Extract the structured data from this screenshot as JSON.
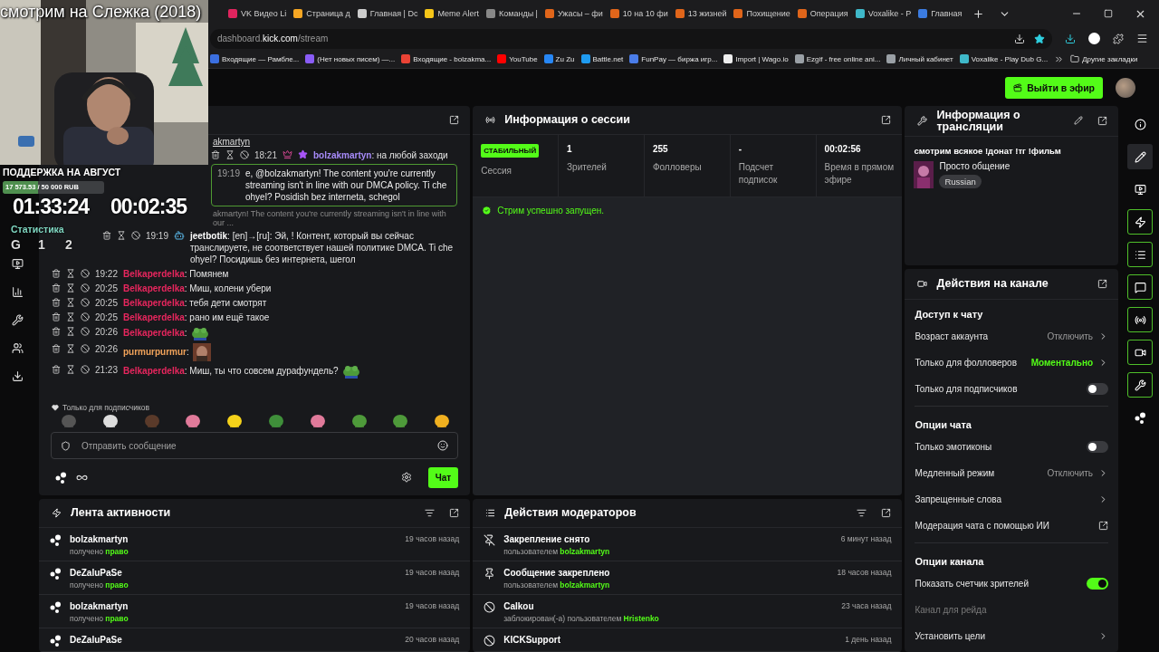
{
  "overlay": {
    "title": "смотрим на Слежка (2018)",
    "goal_title": "ПОДДЕРЖКА НА АВГУСТ",
    "goal_text": "17 573.53 / 50 000 RUB",
    "goal": {
      "level": 0.35
    },
    "timer_total": "01:33:24",
    "timer_session": "00:02:35",
    "stats_label": "Статистика",
    "stats": [
      "G",
      "1",
      "2"
    ]
  },
  "browser": {
    "tabs": [
      {
        "title": "VK Видео Li",
        "color": "#e0245e",
        "selected": false
      },
      {
        "title": "Страница д",
        "color": "#f5a623",
        "selected": false
      },
      {
        "title": "Главная | Dc",
        "color": "#cccccc",
        "selected": false
      },
      {
        "title": "Meme Alert",
        "color": "#f5c518",
        "selected": false
      },
      {
        "title": "Команды | ",
        "color": "#888888",
        "selected": false
      },
      {
        "title": "Ужасы – фи",
        "color": "#e0651a",
        "selected": false
      },
      {
        "title": "10 на 10 фи",
        "color": "#e0651a",
        "selected": false
      },
      {
        "title": "13 жизней",
        "color": "#e0651a",
        "selected": false
      },
      {
        "title": "Похищение",
        "color": "#e0651a",
        "selected": false
      },
      {
        "title": "Операция",
        "color": "#e0651a",
        "selected": false
      },
      {
        "title": "Voxalike - P",
        "color": "#3fb8c9",
        "selected": false
      },
      {
        "title": "Главная",
        "color": "#3b7be0",
        "selected": false
      }
    ],
    "address": {
      "prefix": "dashboard.",
      "host": "kick.com",
      "path": "/stream"
    },
    "bookmarks": [
      {
        "title": "Входящие — Рамбле...",
        "color": "#3b6fe0"
      },
      {
        "title": "(Нет новых писем) —...",
        "color": "#8a5cf6"
      },
      {
        "title": "Входящие - bolzakma...",
        "color": "#ea4335"
      },
      {
        "title": "YouTube",
        "color": "#ff0000"
      },
      {
        "title": "Zu Zu",
        "color": "#2787f5"
      },
      {
        "title": "Battle.net",
        "color": "#1f9bf0"
      },
      {
        "title": "FunPay — биржа игр...",
        "color": "#4a7ce8"
      },
      {
        "title": "Import | Wago.io",
        "color": "#eeeeee"
      },
      {
        "title": "Ezgif - free online ani...",
        "color": "#9aa0a6"
      },
      {
        "title": "Личный кабинет",
        "color": "#9aa0a6"
      },
      {
        "title": "Voxalike - Play Dub G...",
        "color": "#3fb8c9"
      }
    ],
    "other_bookmarks": "Другие закладки"
  },
  "topbar": {
    "go_live": "Выйти в эфир"
  },
  "chat": {
    "pinned_by": "akmartyn",
    "messages": [
      {
        "kind": "message",
        "time": "18:21",
        "badge": {
          "kind": "sub"
        },
        "user": "bolzakmartyn",
        "color": "#a78bfa",
        "text": ": на любой заходи"
      },
      {
        "kind": "pinned",
        "time": "19:19",
        "text": "e, @bolzakmartyn! The content you're currently streaming isn't in line with our DMCA policy. Ti che ohyel? Posidish bez interneta, schegol"
      },
      {
        "kind": "reply",
        "text": "akmartyn! The content you're currently streaming isn't in line with our ..."
      },
      {
        "kind": "message",
        "time": "19:19",
        "badge": {
          "kind": "bot"
        },
        "user": "jeetbotik",
        "color": "#ffffff",
        "text": ": [en]→[ru]: Эй, ! Контент, который вы сейчас транслируете, не соответствует нашей политике DMCA. Ti che ohyel? Посидишь без интернета, шегол"
      },
      {
        "kind": "message",
        "time": "19:22",
        "user": "Belkaperdelka",
        "color": "#e8265e",
        "text": ": Помянем"
      },
      {
        "kind": "message",
        "time": "20:25",
        "user": "Belkaperdelka",
        "color": "#e8265e",
        "text": ": Миш, колени убери"
      },
      {
        "kind": "message",
        "time": "20:25",
        "user": "Belkaperdelka",
        "color": "#e8265e",
        "text": ": тебя дети смотрят"
      },
      {
        "kind": "message",
        "time": "20:25",
        "user": "Belkaperdelka",
        "color": "#e8265e",
        "text": ": рано им ещё такое"
      },
      {
        "kind": "message",
        "time": "20:26",
        "user": "Belkaperdelka",
        "color": "#e8265e",
        "text": ":",
        "emote": {
          "kind": "frog"
        }
      },
      {
        "kind": "message",
        "time": "20:26",
        "user": "purmurpurmur",
        "color": "#f0a25a",
        "text": ":"
      },
      {
        "kind": "message",
        "time": "21:23",
        "user": "Belkaperdelka",
        "color": "#e8265e",
        "text": ": Миш, ты что совсем дурафундель?",
        "emote": {
          "kind": "frog"
        }
      }
    ],
    "emotes_label": "Только для подписчиков",
    "input": {
      "placeholder": "Отправить сообщение"
    },
    "send": "Чат"
  },
  "activity": {
    "title": "Лента активности",
    "rows": [
      {
        "user": "bolzakmartyn",
        "action": "получено",
        "highlight": "право",
        "time": "19 часов назад"
      },
      {
        "user": "DeZaluPaSe",
        "action": "получено",
        "highlight": "право",
        "time": "19 часов назад"
      },
      {
        "user": "bolzakmartyn",
        "action": "получено",
        "highlight": "право",
        "time": "19 часов назад"
      },
      {
        "user": "DeZaluPaSe",
        "time": "20 часов назад"
      }
    ]
  },
  "session": {
    "title": "Информация о сессии",
    "status": "СТАБИЛЬНЫЙ",
    "status_label": "Сессия",
    "stats": [
      {
        "value": "1",
        "label": "Зрителей"
      },
      {
        "value": "255",
        "label": "Фолловеры"
      },
      {
        "value": "-",
        "label": "Подсчет подписок"
      },
      {
        "value": "00:02:56",
        "label": "Время в прямом эфире"
      }
    ],
    "notice": "Стрим успешно запущен."
  },
  "moderation": {
    "title": "Действия модераторов",
    "rows": [
      {
        "kind": "unpin",
        "title": "Закрепление снято",
        "action": "пользователем",
        "user": "bolzakmartyn",
        "time": "6 минут назад"
      },
      {
        "kind": "pin",
        "title": "Сообщение закреплено",
        "action": "пользователем",
        "user": "bolzakmartyn",
        "time": "18 часов назад"
      },
      {
        "kind": "ban",
        "title": "Calkou",
        "action": "заблокирован(-а) пользователем",
        "user": "Hristenko",
        "time": "23 часа назад"
      },
      {
        "kind": "ban",
        "title": "KICKSupport",
        "time": "1 день назад"
      }
    ]
  },
  "stream_info": {
    "title": "Информация о трансляции",
    "stream_title": "смотрим всякое !донат !тг !фильм",
    "category": "Просто общение",
    "tag": "Russian"
  },
  "channel_actions": {
    "title": "Действия на канале",
    "sections": [
      {
        "title": "Доступ к чату",
        "items": [
          {
            "kind": "value",
            "label": "Возраст аккаунта",
            "value": "Отключить",
            "active": false
          },
          {
            "kind": "value",
            "label": "Только для фолловеров",
            "value": "Моментально",
            "active": true
          },
          {
            "kind": "toggle",
            "label": "Только для подписчиков",
            "on": false
          }
        ]
      },
      {
        "title": "Опции чата",
        "items": [
          {
            "kind": "toggle",
            "label": "Только эмотиконы",
            "on": false
          },
          {
            "kind": "value",
            "label": "Медленный режим",
            "value": "Отключить",
            "active": false
          },
          {
            "kind": "link",
            "label": "Запрещенные слова"
          },
          {
            "kind": "external",
            "label": "Модерация чата с помощью ИИ"
          }
        ]
      },
      {
        "title": "Опции канала",
        "items": [
          {
            "kind": "toggle",
            "label": "Показать счетчик зрителей",
            "on": true
          },
          {
            "kind": "muted",
            "label": "Канал для рейда"
          },
          {
            "kind": "link",
            "label": "Установить цели"
          }
        ]
      }
    ]
  },
  "right_rail": [
    {
      "kind": "info",
      "selected": false,
      "on": false
    },
    {
      "kind": "edit",
      "selected": true,
      "on": false
    },
    {
      "kind": "video",
      "selected": false,
      "on": false
    },
    {
      "kind": "bolt",
      "selected": false,
      "on": true
    },
    {
      "kind": "list",
      "selected": false,
      "on": true
    },
    {
      "kind": "chat",
      "selected": false,
      "on": true
    },
    {
      "kind": "broadcast",
      "selected": false,
      "on": true
    },
    {
      "kind": "camera",
      "selected": false,
      "on": true
    },
    {
      "kind": "wrench",
      "selected": false,
      "on": true
    },
    {
      "kind": "dots",
      "selected": false,
      "on": false
    }
  ]
}
